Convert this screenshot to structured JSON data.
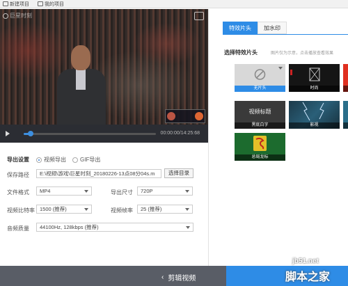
{
  "topbar": {
    "items": [
      {
        "label": "新建项目",
        "icon": "new-project-icon"
      },
      {
        "label": "我的项目",
        "icon": "folder-icon"
      }
    ]
  },
  "player": {
    "logo_text": "巨星时刻",
    "time": "00:00:00/14:25:68",
    "progress": 0.05
  },
  "export": {
    "title": "导出设置",
    "mode_video": "视频导出",
    "mode_gif": "GIF导出",
    "path_label": "保存路径",
    "path_value": "E:\\视频\\游戏\\巨星时刻_20180226-13点08分04s.m",
    "choose_dir": "选择目录",
    "format_label": "文件格式",
    "format_value": "MP4",
    "size_label": "导出尺寸",
    "size_value": "720P",
    "bitrate_label": "视频比特率",
    "bitrate_value": "1500 (推荐)",
    "fps_label": "视频帧率",
    "fps_value": "25 (推荐)",
    "audio_label": "音频质量",
    "audio_value": "44100Hz, 128kbps (推荐)"
  },
  "bottom": {
    "back_label": "剪辑视频"
  },
  "watermark": {
    "site": "jb51.net",
    "name": "脚本之家"
  },
  "right": {
    "tabs": [
      "特效片头",
      "加水印"
    ],
    "section_title": "选择特效片头",
    "section_hint": "图片仅为示意，点击播放查看效果",
    "cards": [
      {
        "label": "无片头",
        "selected": true
      },
      {
        "label": "时尚",
        "selected": false
      },
      {
        "label": "",
        "selected": false
      },
      {
        "label": "黑底白字",
        "selected": false,
        "thumb_text": "视频标题"
      },
      {
        "label": "影视",
        "selected": false
      },
      {
        "label": "",
        "selected": false
      },
      {
        "label": "总局龙标",
        "selected": false
      }
    ]
  }
}
